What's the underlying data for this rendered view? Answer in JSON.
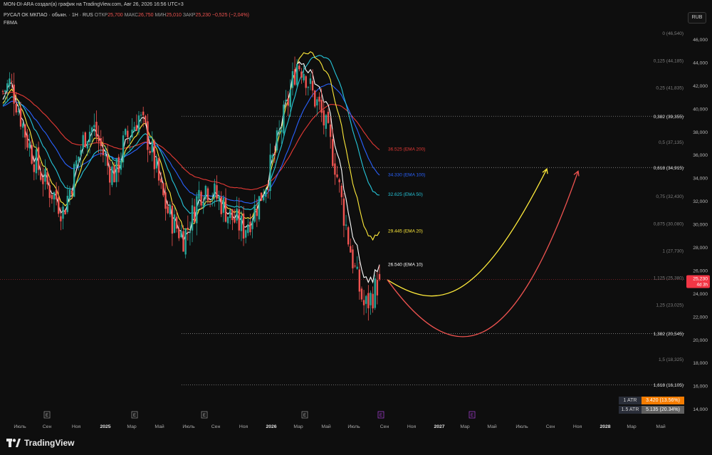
{
  "header": {
    "caption": "MON-DI-ARA создал(а) график на TradingView.com, Авг 26, 2026 16:56 UTC+3"
  },
  "symbol_bar": {
    "title": "РУСАЛ ОК МКПАО · обыкн. · 1H · RUS",
    "o_label": "ОТКР",
    "o_val": "25,700",
    "h_label": "МАКС",
    "h_val": "26,750",
    "l_label": "МИН",
    "l_val": "25,010",
    "c_label": "ЗАКР",
    "c_val": "25,230",
    "chg": "−0,525 (−2,04%)",
    "indicator": "FBMA"
  },
  "currency_button": "RUB",
  "price_axis": {
    "ticks": [
      "46,000",
      "44,000",
      "42,000",
      "40,000",
      "38,000",
      "36,000",
      "34,000",
      "32,000",
      "30,000",
      "28,000",
      "26,000",
      "24,000",
      "22,000",
      "20,000",
      "18,000",
      "16,000",
      "14,000"
    ],
    "last_price": "25,230",
    "last_price_timer": "4d 3h",
    "last_price_color": "#f23645"
  },
  "time_axis": {
    "labels": [
      "Июль",
      "Сен",
      "Ноя",
      "2025",
      "Мар",
      "Май",
      "Июль",
      "Сен",
      "Ноя",
      "2026",
      "Мар",
      "Май",
      "Июль",
      "Сен",
      "Ноя",
      "2027",
      "Мар",
      "Май",
      "Июль",
      "Сен",
      "Ноя",
      "2028",
      "Мар",
      "Май"
    ],
    "event_marker": "E"
  },
  "fib_levels": [
    {
      "label": "0 (46,540)",
      "value": 46.54,
      "bold": false
    },
    {
      "label": "0,125 (44,185)",
      "value": 44.185,
      "bold": false
    },
    {
      "label": "0,25 (41,835)",
      "value": 41.835,
      "bold": false
    },
    {
      "label": "0,382 (39,355)",
      "value": 39.355,
      "bold": true
    },
    {
      "label": "0,5 (37,135)",
      "value": 37.135,
      "bold": false
    },
    {
      "label": "0,618 (34,915)",
      "value": 34.915,
      "bold": true
    },
    {
      "label": "0,75 (32,430)",
      "value": 32.43,
      "bold": false
    },
    {
      "label": "0,875 (30,080)",
      "value": 30.08,
      "bold": false
    },
    {
      "label": "1 (27,730)",
      "value": 27.73,
      "bold": false
    },
    {
      "label": "1,125 (25,380)",
      "value": 25.38,
      "bold": false
    },
    {
      "label": "1,25 (23,025)",
      "value": 23.025,
      "bold": false
    },
    {
      "label": "1,382 (20,545)",
      "value": 20.545,
      "bold": true
    },
    {
      "label": "1,5 (18,325)",
      "value": 18.325,
      "bold": false
    },
    {
      "label": "1,618 (16,105)",
      "value": 16.105,
      "bold": true
    }
  ],
  "ema_labels": [
    {
      "label": "36.525 (EMA 200)",
      "value": 36.525,
      "color": "#e53935"
    },
    {
      "label": "34.330 (EMA 100)",
      "value": 34.33,
      "color": "#2962ff"
    },
    {
      "label": "32.625 (EMA 50)",
      "value": 32.625,
      "color": "#26c6da"
    },
    {
      "label": "29.445 (EMA 20)",
      "value": 29.445,
      "color": "#ffeb3b"
    },
    {
      "label": "26.540 (EMA 10)",
      "value": 26.54,
      "color": "#ffffff"
    }
  ],
  "atr": [
    {
      "label": "1 ATR",
      "value": "3.420 (13.56%)",
      "color": "#f57c00"
    },
    {
      "label": "1.5 ATR",
      "value": "5.135 (20.34%)",
      "color": "#616161"
    }
  ],
  "logo_text": "TradingView",
  "colors": {
    "up": "#26a69a",
    "down": "#ef5350",
    "background": "#0e0e0e",
    "projection_yellow": "#ffeb3b",
    "projection_red": "#ef5350"
  },
  "chart_data": {
    "type": "candlestick",
    "y_range": [
      13.3,
      47.2
    ],
    "price_scale": "linear",
    "x_categories": [
      "Июль",
      "Сен",
      "Ноя",
      "2025",
      "Мар",
      "Май",
      "Июль",
      "Сен",
      "Ноя",
      "2026",
      "Мар",
      "Май",
      "Июль",
      "Сен"
    ],
    "close_path": [
      41.5,
      42.3,
      40.2,
      37.8,
      35.9,
      34.5,
      33.2,
      32.4,
      31.1,
      33.3,
      35.8,
      37.9,
      38.4,
      36.7,
      34.9,
      34.3,
      36.9,
      38.1,
      39.4,
      37.9,
      35.7,
      32.8,
      30.9,
      29.8,
      28.9,
      30.4,
      32.7,
      33.3,
      32.6,
      31.9,
      30.8,
      30.2,
      29.6,
      30.8,
      32.0,
      33.8,
      35.9,
      38.5,
      41.0,
      44.0,
      43.4,
      41.4,
      40.1,
      38.0,
      35.6,
      31.8,
      28.3,
      25.2,
      22.8,
      23.8,
      25.2
    ],
    "last_candle": {
      "open": 25.7,
      "high": 26.75,
      "low": 25.01,
      "close": 25.23
    },
    "projections": [
      {
        "name": "",
        "points": [
          [
            0,
            25.2
          ],
          [
            0.3,
            22.6
          ],
          [
            0.55,
            22.5
          ],
          [
            1,
            34.8
          ]
        ]
      },
      {
        "name": "",
        "points": [
          [
            0,
            25.2
          ],
          [
            0.35,
            17.2
          ],
          [
            0.65,
            18.0
          ],
          [
            1,
            34.6
          ]
        ]
      }
    ]
  }
}
